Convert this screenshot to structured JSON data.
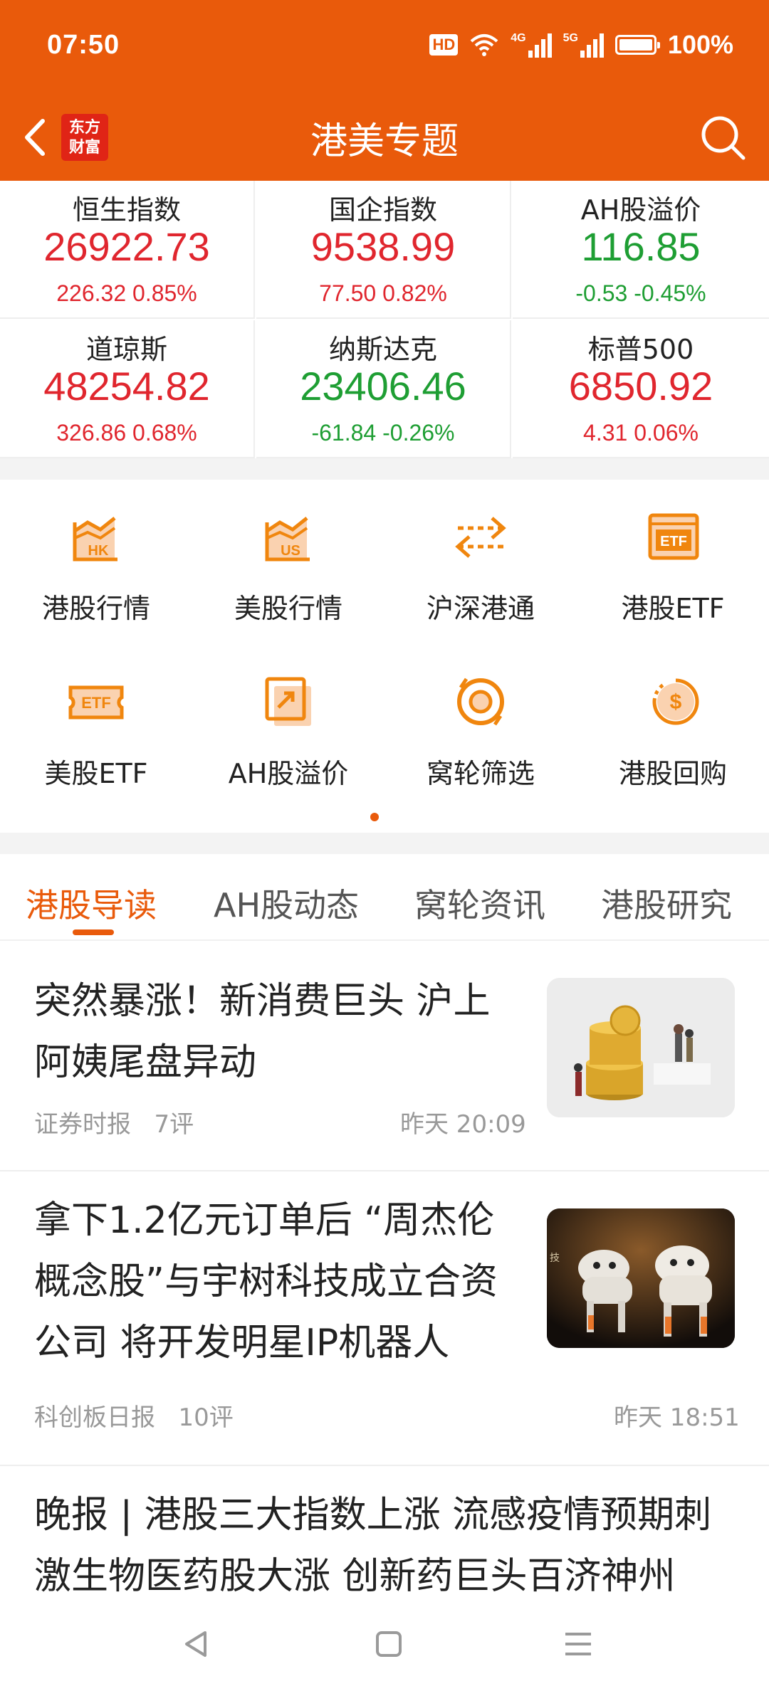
{
  "status": {
    "time": "07:50",
    "battery": "100%",
    "hd": "HD",
    "net1": "4G",
    "net2": "5G"
  },
  "header": {
    "title": "港美专题",
    "logo_line1": "东方",
    "logo_line2": "财富"
  },
  "market": [
    {
      "name": "恒生指数",
      "value": "26922.73",
      "change": "226.32  0.85%",
      "trend": "up"
    },
    {
      "name": "国企指数",
      "value": "9538.99",
      "change": "77.50  0.82%",
      "trend": "up"
    },
    {
      "name": "AH股溢价",
      "value": "116.85",
      "change": "-0.53  -0.45%",
      "trend": "down"
    },
    {
      "name": "道琼斯",
      "value": "48254.82",
      "change": "326.86  0.68%",
      "trend": "up"
    },
    {
      "name": "纳斯达克",
      "value": "23406.46",
      "change": "-61.84  -0.26%",
      "trend": "down"
    },
    {
      "name": "标普500",
      "value": "6850.92",
      "change": "4.31  0.06%",
      "trend": "up"
    }
  ],
  "quick": [
    {
      "label": "港股行情",
      "icon": "hk-chart-icon",
      "badge": "HK"
    },
    {
      "label": "美股行情",
      "icon": "us-chart-icon",
      "badge": "US"
    },
    {
      "label": "沪深港通",
      "icon": "exchange-arrows-icon"
    },
    {
      "label": "港股ETF",
      "icon": "etf-icon",
      "badge": "ETF"
    },
    {
      "label": "美股ETF",
      "icon": "etf-ticket-icon",
      "badge": "ETF"
    },
    {
      "label": "AH股溢价",
      "icon": "premium-icon"
    },
    {
      "label": "窝轮筛选",
      "icon": "warrant-filter-icon"
    },
    {
      "label": "港股回购",
      "icon": "buyback-icon",
      "badge": "$"
    }
  ],
  "tabs": [
    "港股导读",
    "AH股动态",
    "窝轮资讯",
    "港股研究"
  ],
  "news": [
    {
      "headline": "突然暴涨！新消费巨头 沪上阿姨尾盘异动",
      "source": "证券时报",
      "comments": "7评",
      "time": "昨天 20:09"
    },
    {
      "headline": "拿下1.2亿元订单后 “周杰伦概念股”与宇树科技成立合资公司 将开发明星IP机器人",
      "source": "科创板日报",
      "comments": "10评",
      "time": "昨天 18:51",
      "thumb_text": "技"
    },
    {
      "headline": "晚报 | 港股三大指数上涨 流感疫情预期刺激生物医药股大涨 创新药巨头百济神州"
    }
  ],
  "colors": {
    "brand": "#E95A0B",
    "up": "#E0262E",
    "down": "#1E9E33"
  }
}
